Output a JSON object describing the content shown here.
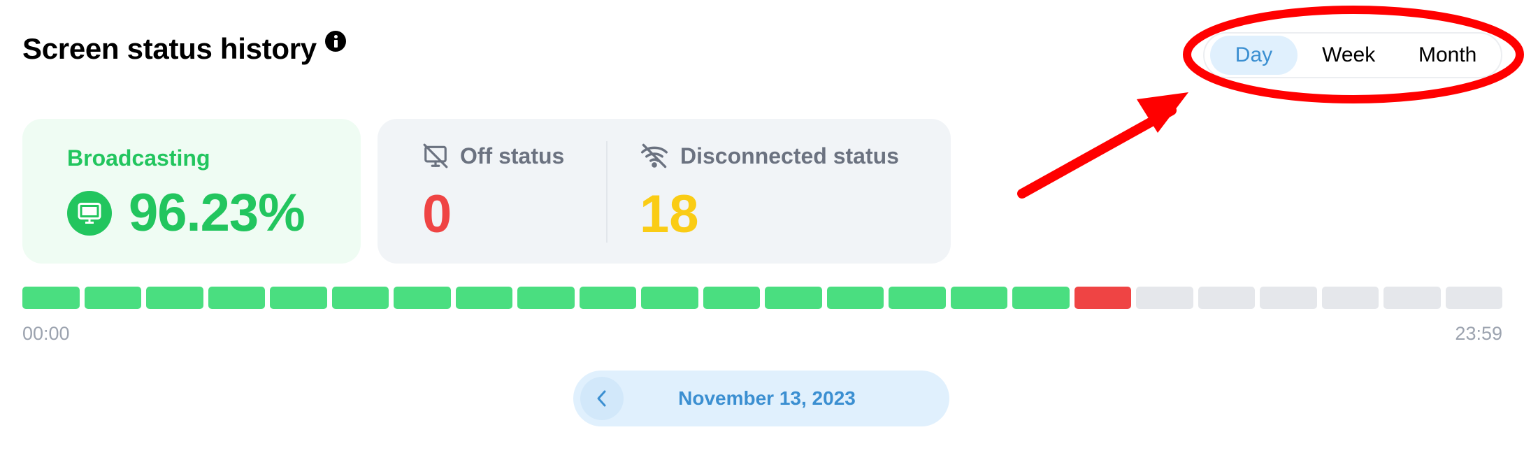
{
  "header": {
    "title": "Screen status history",
    "info_icon": "info-icon"
  },
  "range_toggle": {
    "options": [
      "Day",
      "Week",
      "Month"
    ],
    "selected": "Day"
  },
  "broadcasting": {
    "label": "Broadcasting",
    "value": "96.23%",
    "icon": "monitor-icon"
  },
  "off_status": {
    "label": "Off status",
    "value": "0",
    "icon": "monitor-off-icon"
  },
  "disconnected_status": {
    "label": "Disconnected status",
    "value": "18",
    "icon": "wifi-off-icon"
  },
  "timeline": {
    "start_label": "00:00",
    "end_label": "23:59",
    "segments": [
      "broadcasting",
      "broadcasting",
      "broadcasting",
      "broadcasting",
      "broadcasting",
      "broadcasting",
      "broadcasting",
      "broadcasting",
      "broadcasting",
      "broadcasting",
      "broadcasting",
      "broadcasting",
      "broadcasting",
      "broadcasting",
      "broadcasting",
      "broadcasting",
      "broadcasting",
      "off",
      "none",
      "none",
      "none",
      "none",
      "none",
      "none"
    ]
  },
  "date_nav": {
    "date": "November 13, 2023",
    "prev_icon": "chevron-left-icon"
  },
  "colors": {
    "broadcasting": "#4ade80",
    "off": "#ef4444",
    "none": "#e5e7eb",
    "accent": "#3b8fd1",
    "annotation": "#ff0000"
  }
}
